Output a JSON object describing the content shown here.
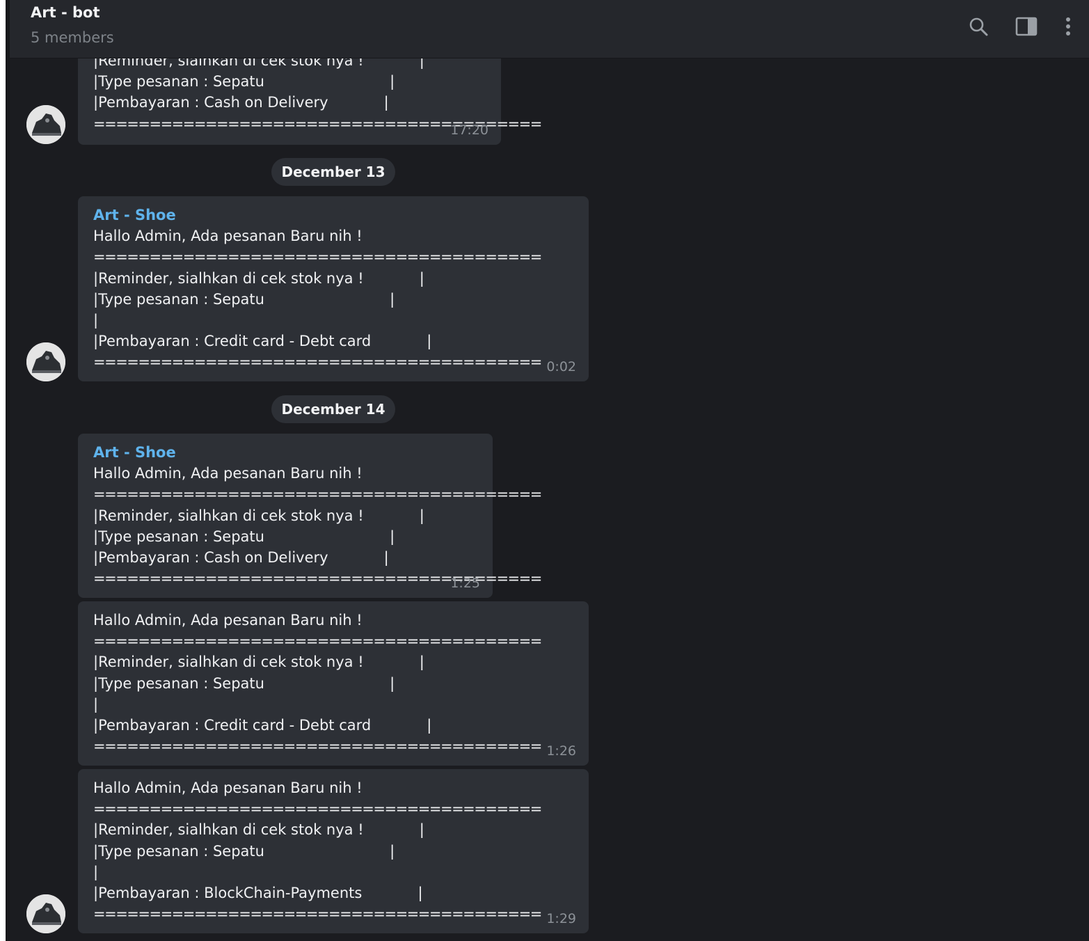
{
  "header": {
    "title": "Art - bot",
    "subtitle": "5 members",
    "icons": [
      "search-icon",
      "sidebar-toggle-icon",
      "more-vertical-icon"
    ]
  },
  "colors": {
    "background": "#1b1c20",
    "header": "#25272c",
    "bubble": "#2d3036",
    "sender": "#5fb3ec",
    "text": "#f0f1f3",
    "time": "#8c9197"
  },
  "dates": [
    "December 13",
    "December 14"
  ],
  "messages": [
    {
      "sender": "",
      "lines": [
        "|Reminder, sialhkan di cek stok nya !            |",
        "|Type pesanan : Sepatu                           |",
        "|Pembayaran : Cash on Delivery            |",
        "========================================"
      ],
      "time": "17:20"
    },
    {
      "sender": "Art - Shoe",
      "lines": [
        "Hallo Admin, Ada pesanan Baru nih !",
        "========================================",
        "|Reminder, sialhkan di cek stok nya !            |",
        "|Type pesanan : Sepatu                           |",
        "|",
        "|Pembayaran : Credit card - Debt card            |",
        "========================================"
      ],
      "time": "0:02"
    },
    {
      "sender": "Art - Shoe",
      "lines": [
        "Hallo Admin, Ada pesanan Baru nih !",
        "========================================",
        "|Reminder, sialhkan di cek stok nya !            |",
        "|Type pesanan : Sepatu                           |",
        "|Pembayaran : Cash on Delivery            |",
        "========================================"
      ],
      "time": "1:25"
    },
    {
      "sender": "",
      "lines": [
        "Hallo Admin, Ada pesanan Baru nih !",
        "========================================",
        "|Reminder, sialhkan di cek stok nya !            |",
        "|Type pesanan : Sepatu                           |",
        "|",
        "|Pembayaran : Credit card - Debt card            |",
        "========================================"
      ],
      "time": "1:26"
    },
    {
      "sender": "",
      "lines": [
        "Hallo Admin, Ada pesanan Baru nih !",
        "========================================",
        "|Reminder, sialhkan di cek stok nya !            |",
        "|Type pesanan : Sepatu                           |",
        "|",
        "|Pembayaran : BlockChain-Payments            |",
        "========================================"
      ],
      "time": "1:29"
    }
  ]
}
